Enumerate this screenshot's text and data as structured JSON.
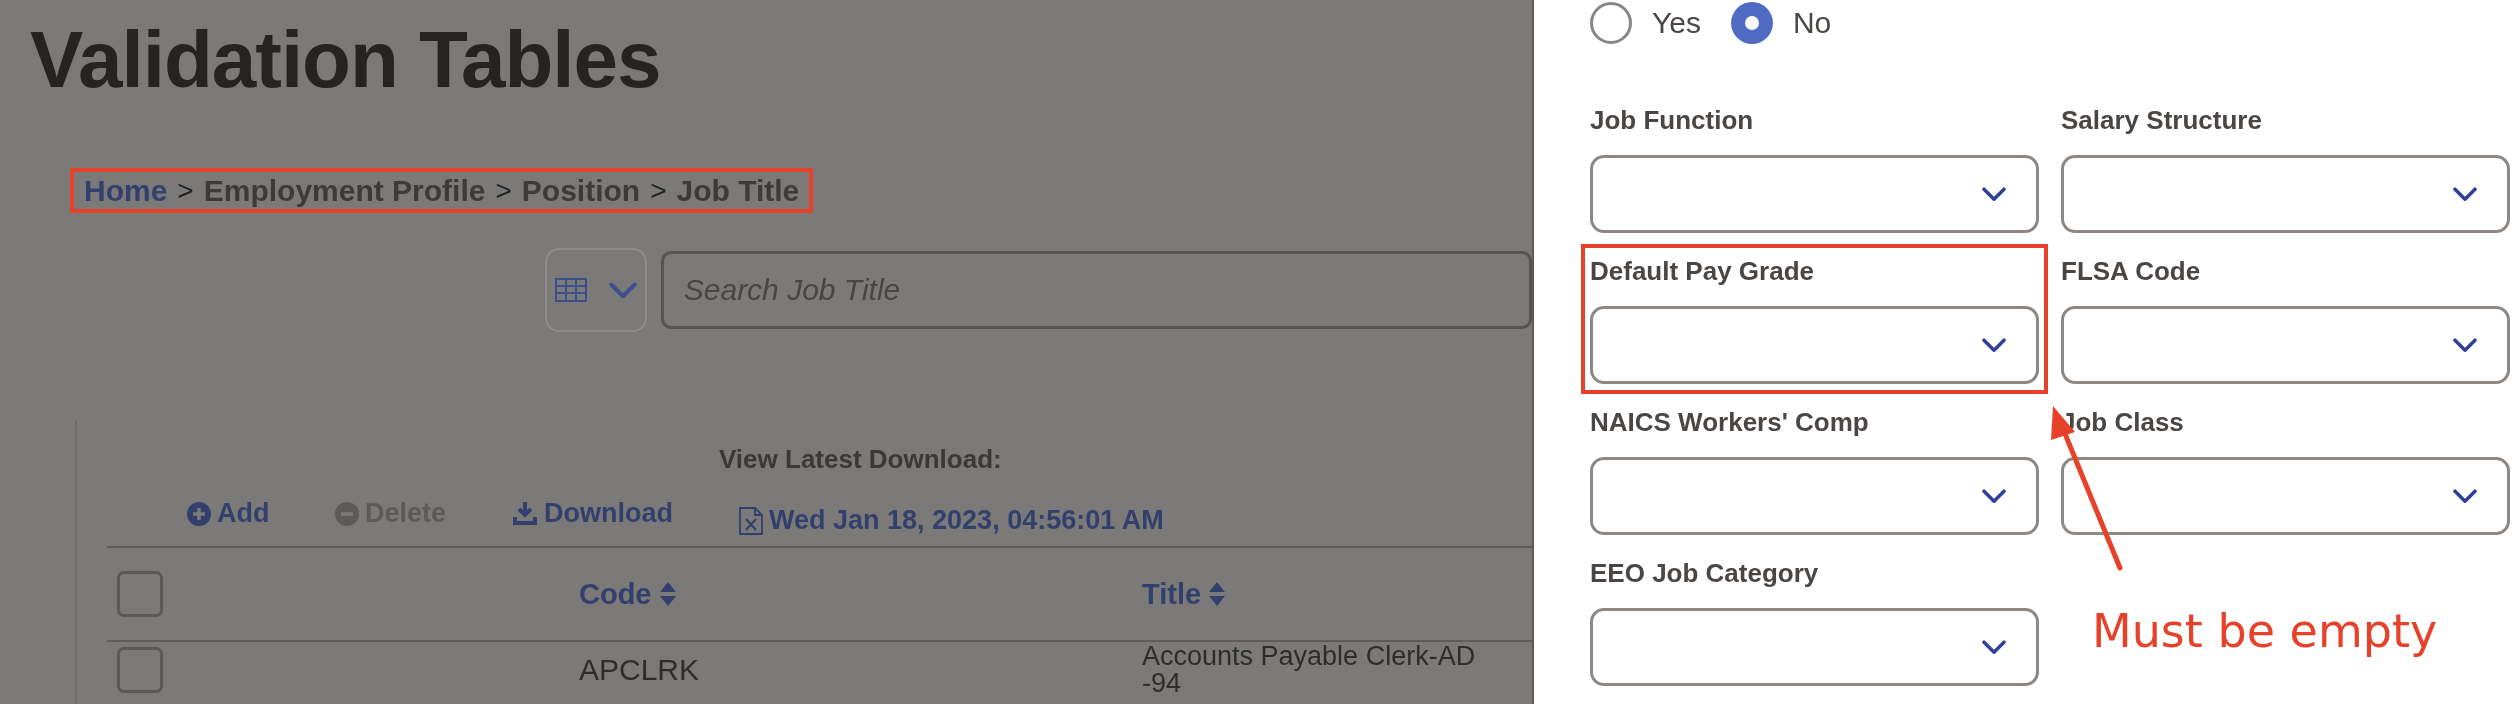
{
  "page": {
    "title": "Validation Tables"
  },
  "breadcrumb": {
    "highlighted": true,
    "items": [
      {
        "label": "Home",
        "kind": "link"
      },
      {
        "separator": ">",
        "label": "Employment Profile",
        "kind": "text"
      },
      {
        "separator": ">",
        "label": "Position",
        "kind": "text"
      },
      {
        "separator": ">",
        "label": "Job Title",
        "kind": "text"
      }
    ]
  },
  "search": {
    "placeholder": "Search Job Title"
  },
  "latest_download": {
    "label": "View Latest Download:",
    "file": "Wed Jan 18, 2023, 04:56:01 AM"
  },
  "toolbar": [
    {
      "label": "Add",
      "kind": "add",
      "disabled": false
    },
    {
      "label": "Delete",
      "kind": "delete",
      "disabled": true
    },
    {
      "label": "Download",
      "kind": "download",
      "disabled": false
    }
  ],
  "table": {
    "all_checked": false,
    "columns": [
      {
        "label": "Code"
      },
      {
        "label": "Title"
      }
    ],
    "rows": [
      {
        "checked": false,
        "code": "APCLRK",
        "title_lines": [
          "Accounts Payable Clerk-AD",
          "-94"
        ]
      }
    ]
  },
  "panel": {
    "radio": [
      {
        "label": "Yes",
        "selected": false
      },
      {
        "label": "No",
        "selected": true
      }
    ],
    "fields": [
      {
        "label": "Job Function",
        "highlighted": false
      },
      {
        "label": "Salary Structure",
        "highlighted": false
      },
      {
        "label": "Default Pay Grade",
        "highlighted": true
      },
      {
        "label": "FLSA Code",
        "highlighted": false
      },
      {
        "label": "NAICS Workers' Comp",
        "highlighted": false
      },
      {
        "label": "Job Class",
        "highlighted": false
      },
      {
        "label": "EEO Job Category",
        "highlighted": false
      }
    ],
    "callout": {
      "text": "Must be empty"
    }
  }
}
